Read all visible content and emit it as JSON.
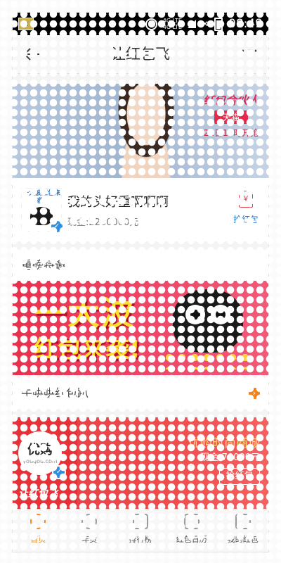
{
  "status_bar": {
    "network_top": "4G LTE",
    "network_bottom": "4G LTE",
    "time": "08:49"
  },
  "header": {
    "title": "让红包飞",
    "more": "···"
  },
  "card_featured": {
    "promo_brand": "红包合伙人",
    "promo_store": "天猫",
    "promo_time": "21日10时开抢",
    "logo_text": "一大波红包来袭!",
    "name": "我的头好重啊啊啊",
    "cash": "现金:2260000元",
    "grab_icon": "¥",
    "grab_label": "抢红包"
  },
  "section_invite": {
    "title": "重磅特邀",
    "banner_line1": "一大波",
    "banner_line2": "红包来袭!"
  },
  "section_niu": {
    "title": "牛哄哄红包趴",
    "arrow": "›"
  },
  "card_yougou": {
    "logo_cn": "优购",
    "logo_en": "yougou.com",
    "brand": "让红包飞",
    "shop_name": "优购时尚商城",
    "cash": "现金:70000元",
    "grab_label": "抢红包"
  },
  "tabs": [
    {
      "label": "首页",
      "active": true
    },
    {
      "label": "年货",
      "active": false
    },
    {
      "label": "排行榜",
      "active": false
    },
    {
      "label": "红包日历",
      "active": false
    },
    {
      "label": "我的红包",
      "active": false
    }
  ],
  "colors": {
    "accent": "#f08a1d",
    "red": "#e6394a",
    "link_blue": "#1b76c9"
  }
}
